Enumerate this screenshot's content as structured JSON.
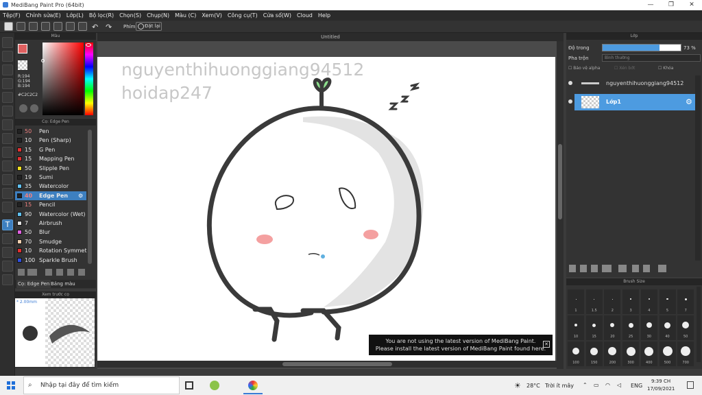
{
  "window": {
    "title": "MediBang Paint Pro (64bit)"
  },
  "menu": [
    "Tệp(F)",
    "Chỉnh sửa(E)",
    "Lớp(L)",
    "Bộ lọc(R)",
    "Chọn(S)",
    "Chụp(N)",
    "Màu (C)",
    "Xem(V)",
    "Công cụ(T)",
    "Cửa sổ(W)",
    "Cloud",
    "Help"
  ],
  "toolbar": {
    "shortcut_label": "Phím",
    "reset_label": "Đặt lại"
  },
  "color_panel": {
    "title": "Màu",
    "r": "R:194",
    "g": "G:194",
    "b": "B:194",
    "hex": "#C2C2C2",
    "fg": "#e06060",
    "picked": "#c2c2c2"
  },
  "brush_panel": {
    "title": "Cọ: Edge Pen",
    "items": [
      {
        "size": "50",
        "name": "Pen",
        "color": "#222222"
      },
      {
        "size": "10",
        "name": "Pen (Sharp)",
        "color": "#222222"
      },
      {
        "size": "15",
        "name": "G Pen",
        "color": "#e03030"
      },
      {
        "size": "15",
        "name": "Mapping Pen",
        "color": "#e03030"
      },
      {
        "size": "50",
        "name": "Slipple Pen",
        "color": "#f0e020"
      },
      {
        "size": "19",
        "name": "Sumi",
        "color": "#222222"
      },
      {
        "size": "35",
        "name": "Watercolor",
        "color": "#60c0f0"
      },
      {
        "size": "40",
        "name": "Edge Pen",
        "color": "#222222"
      },
      {
        "size": "15",
        "name": "Pencil",
        "color": "#222222"
      },
      {
        "size": "90",
        "name": "Watercolor (Wet)",
        "color": "#60c0f0"
      },
      {
        "size": "7",
        "name": "Airbrush",
        "color": "#e0e0e0"
      },
      {
        "size": "50",
        "name": "Blur",
        "color": "#e060e0"
      },
      {
        "size": "70",
        "name": "Smudge",
        "color": "#f0d0b0"
      },
      {
        "size": "10",
        "name": "Rotation Symmetry",
        "color": "#e03030"
      },
      {
        "size": "100",
        "name": "Sparkle Brush",
        "color": "#3050e0"
      }
    ],
    "tab_brush": "Cọ: Edge Pen",
    "tab_palette": "Bảng màu"
  },
  "preview_panel": {
    "title": "Xem trước cọ",
    "size": "* 2.00mm"
  },
  "document": {
    "tab": "Untitled",
    "watermark_1": "nguyenthihuonggiang94512",
    "watermark_2": "hoidap247"
  },
  "layer_panel": {
    "title": "Lớp",
    "opacity_label": "Độ trong",
    "opacity_value": "73 %",
    "opacity": 0.73,
    "blend_label": "Pha trộn",
    "blend_value": "Bình thường",
    "protect_alpha": "Bảo vệ alpha",
    "clipping": "Xén bớt",
    "lock": "Khóa",
    "layers": [
      {
        "name": "nguyenthihuonggiang94512"
      },
      {
        "name": "Lớp1"
      }
    ]
  },
  "brush_size_panel": {
    "title": "Brush Size",
    "sizes": [
      "1",
      "1.5",
      "2",
      "3",
      "4",
      "5",
      "7",
      "10",
      "15",
      "20",
      "25",
      "30",
      "40",
      "50",
      "100",
      "150",
      "200",
      "300",
      "400",
      "500",
      "700"
    ]
  },
  "notification": {
    "line1": "You are not using the latest version of MediBang Paint.",
    "line2": "Please install the latest version of MediBang Paint found here."
  },
  "taskbar": {
    "search_placeholder": "Nhập tại đây để tìm kiếm",
    "weather_temp": "28°C",
    "weather_desc": "Trời ít mây",
    "lang": "ENG",
    "time": "9:39 CH",
    "date": "17/09/2021"
  }
}
